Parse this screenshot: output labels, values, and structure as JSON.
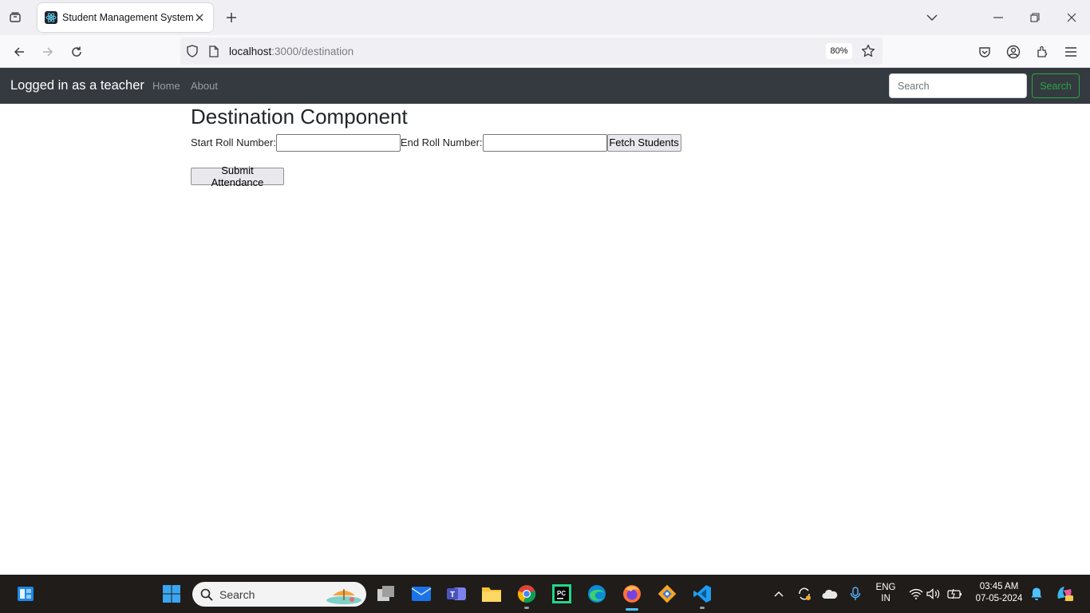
{
  "browser": {
    "tab_title": "Student Management System",
    "url_host": "localhost",
    "url_path": ":3000/destination",
    "zoom": "80%"
  },
  "app": {
    "brand": "Logged in as a teacher",
    "nav": {
      "home": "Home",
      "about": "About"
    },
    "search": {
      "placeholder": "Search",
      "button": "Search"
    }
  },
  "page": {
    "title": "Destination Component",
    "start_label": "Start Roll Number:",
    "start_value": "",
    "end_label": "End Roll Number:",
    "end_value": "",
    "fetch_button": "Fetch Students",
    "submit_button": "Submit Attendance"
  },
  "taskbar": {
    "search_placeholder": "Search",
    "language": "ENG",
    "region": "IN",
    "time": "03:45 AM",
    "date": "07-05-2024"
  },
  "colors": {
    "navbar_bg": "#343a40",
    "search_green": "#28a745",
    "taskbar_bg": "#1f1c1a"
  }
}
